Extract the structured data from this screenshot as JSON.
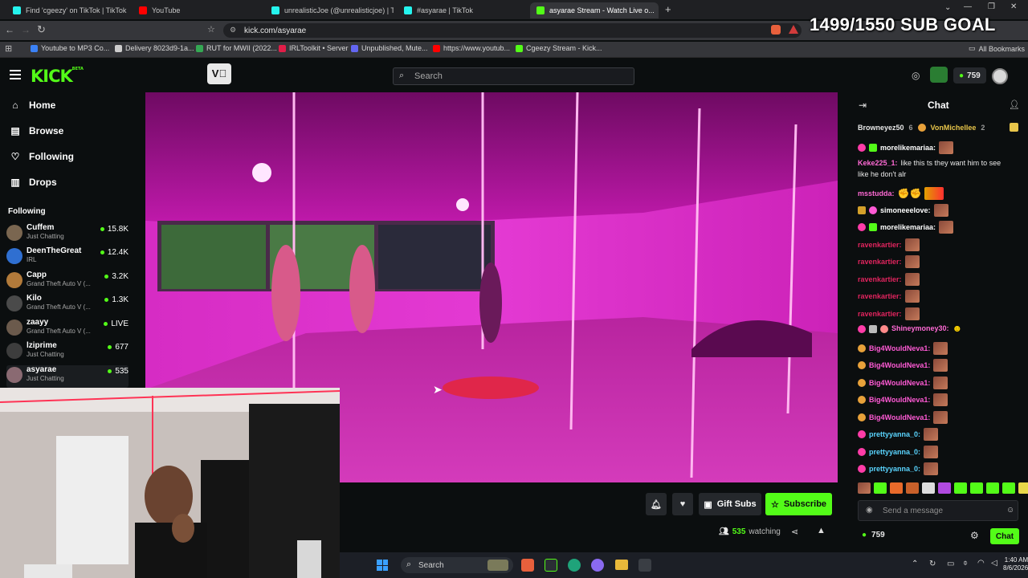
{
  "browser": {
    "tabs": [
      {
        "title": "Find 'cgeezy' on TikTok | TikTok Sear...",
        "color": "#25f4ee"
      },
      {
        "title": "YouTube",
        "color": "#ff0000"
      },
      {
        "title": "unrealisticJoe (@unrealisticjoe) | TikT...",
        "color": "#25f4ee"
      },
      {
        "title": "#asyarae | TikTok",
        "color": "#25f4ee"
      },
      {
        "title": "asyarae Stream - Watch Live o...",
        "color": "#53fc18"
      }
    ],
    "url": "kick.com/asyarae",
    "bookmarks": [
      {
        "label": "Youtube to MP3 Co...",
        "color": "#3b82f6"
      },
      {
        "label": "Delivery 8023d9-1a...",
        "color": "#cccccc"
      },
      {
        "label": "RUT for MWII (2022...",
        "color": "#34a853"
      },
      {
        "label": "IRLToolkit • Server",
        "color": "#e11d48"
      },
      {
        "label": "Unpublished, Mute...",
        "color": "#6366f1"
      },
      {
        "label": "https://www.youtub...",
        "color": "#ff0000"
      },
      {
        "label": "Cgeezy Stream - Kick...",
        "color": "#53fc18"
      }
    ],
    "all_bookmarks": "All Bookmarks"
  },
  "overlay": {
    "sub_goal": "1499/1550 SUB GOAL"
  },
  "header": {
    "logo": "KICK",
    "logo_tag": "BETA",
    "search_placeholder": "Search",
    "kicks_balance": "759"
  },
  "sidebar": {
    "nav": [
      {
        "label": "Home",
        "icon": "home-icon"
      },
      {
        "label": "Browse",
        "icon": "browse-icon"
      },
      {
        "label": "Following",
        "icon": "heart-icon"
      },
      {
        "label": "Drops",
        "icon": "drops-icon"
      }
    ],
    "following_title": "Following",
    "following": [
      {
        "name": "Cuffem",
        "category": "Just Chatting",
        "viewers": "15.8K",
        "avatar_color": "#7a6650"
      },
      {
        "name": "DeenTheGreat",
        "category": "IRL",
        "viewers": "12.4K",
        "avatar_color": "#2f6fd1"
      },
      {
        "name": "Capp",
        "category": "Grand Theft Auto V (...",
        "viewers": "3.2K",
        "avatar_color": "#b27a3a"
      },
      {
        "name": "Kilo",
        "category": "Grand Theft Auto V (...",
        "viewers": "1.3K",
        "avatar_color": "#4a4a4a"
      },
      {
        "name": "zaayy",
        "category": "Grand Theft Auto V (...",
        "viewers": "LIVE",
        "avatar_color": "#6b5a4c"
      },
      {
        "name": "lziprime",
        "category": "Just Chatting",
        "viewers": "677",
        "avatar_color": "#3d3d3d"
      },
      {
        "name": "asyarae",
        "category": "Just Chatting",
        "viewers": "535",
        "avatar_color": "#8a6a72"
      }
    ]
  },
  "chat": {
    "title": "Chat",
    "top_gifters": [
      {
        "name": "Browneyez50",
        "count": "6"
      },
      {
        "name": "VonMichellee",
        "count": "2"
      }
    ],
    "messages": [
      {
        "user": "morelikemariaa:",
        "color": "#ffffff",
        "text": ""
      },
      {
        "user": "Keke225_1:",
        "color": "#ff6ad5",
        "text": "like this ts they want him to see"
      },
      {
        "user": "",
        "color": "#ffffff",
        "text": "like he don't alr"
      },
      {
        "user": "msstudda:",
        "color": "#ff6ad5",
        "text": ""
      },
      {
        "user": "simoneeelove:",
        "color": "#ffffff",
        "text": ""
      },
      {
        "user": "morelikemariaa:",
        "color": "#ffffff",
        "text": ""
      },
      {
        "user": "ravenkartier:",
        "color": "#e0245e",
        "text": ""
      },
      {
        "user": "ravenkartier:",
        "color": "#e0245e",
        "text": ""
      },
      {
        "user": "ravenkartier:",
        "color": "#e0245e",
        "text": ""
      },
      {
        "user": "ravenkartier:",
        "color": "#e0245e",
        "text": ""
      },
      {
        "user": "ravenkartier:",
        "color": "#e0245e",
        "text": ""
      },
      {
        "user": "Shineymoney30:",
        "color": "#ff6ad5",
        "text": ""
      },
      {
        "user": "Big4WouldNeva1:",
        "color": "#ff5ad5",
        "text": ""
      },
      {
        "user": "Big4WouldNeva1:",
        "color": "#ff5ad5",
        "text": ""
      },
      {
        "user": "Big4WouldNeva1:",
        "color": "#ff5ad5",
        "text": ""
      },
      {
        "user": "Big4WouldNeva1:",
        "color": "#ff5ad5",
        "text": ""
      },
      {
        "user": "Big4WouldNeva1:",
        "color": "#ff5ad5",
        "text": ""
      },
      {
        "user": "prettyyanna_0:",
        "color": "#5ad5ff",
        "text": ""
      },
      {
        "user": "prettyyanna_0:",
        "color": "#5ad5ff",
        "text": ""
      },
      {
        "user": "prettyyanna_0:",
        "color": "#5ad5ff",
        "text": ""
      }
    ],
    "input_placeholder": "Send a message",
    "kicks": "759",
    "send_label": "Chat"
  },
  "stream": {
    "gift_subs_label": "Gift Subs",
    "subscribe_label": "Subscribe",
    "viewers": "535",
    "watching_label": "watching"
  },
  "taskbar": {
    "search_placeholder": "Search",
    "time": "1:40 AM",
    "date": "8/6/2026"
  },
  "colors": {
    "accent": "#53fc18",
    "background": "#0b0e0f"
  }
}
